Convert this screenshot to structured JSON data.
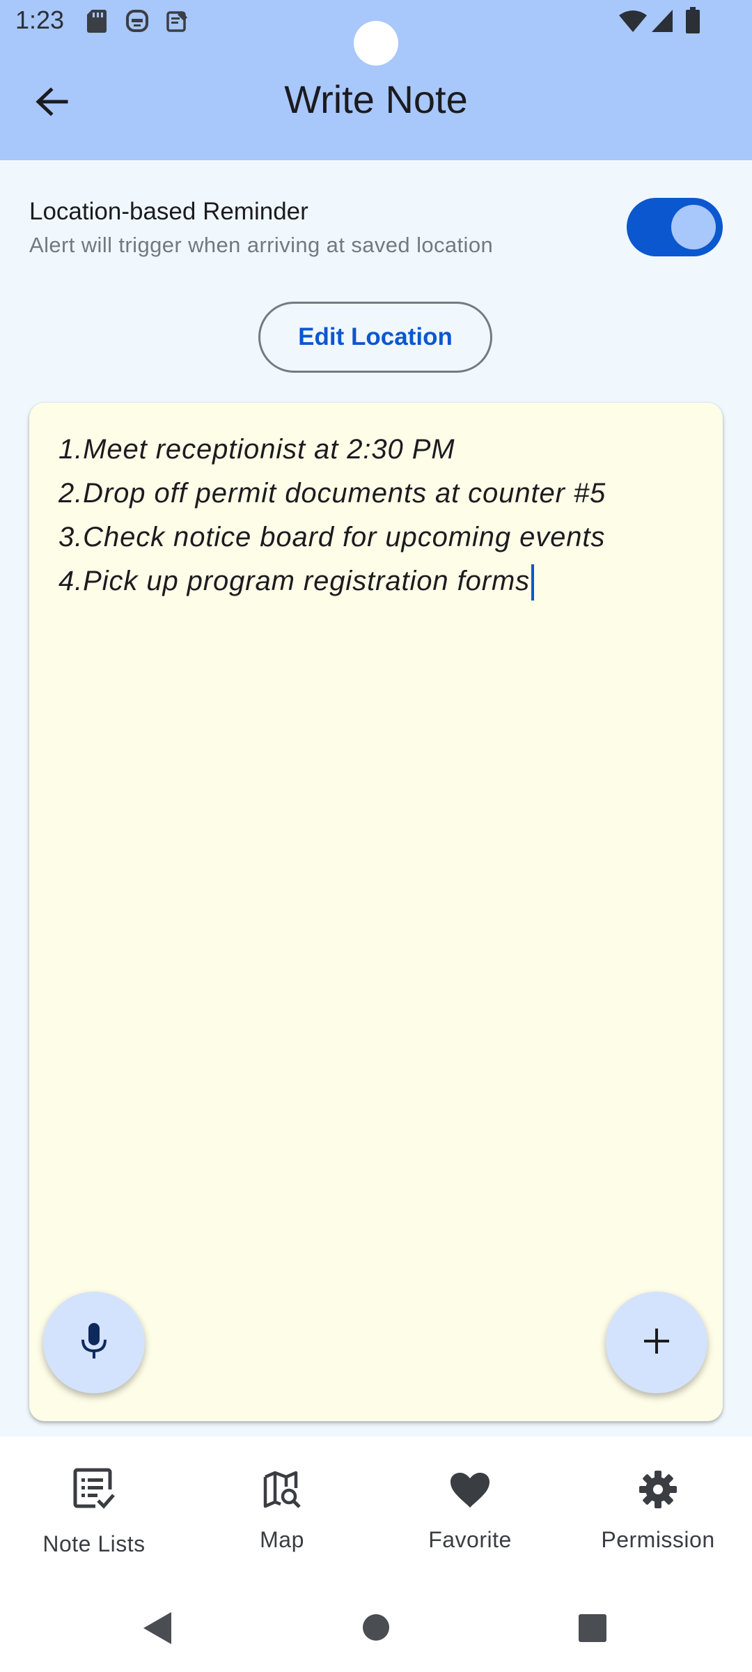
{
  "status_bar": {
    "time": "1:23",
    "left_icons": [
      "sd-card-icon",
      "assistant-icon",
      "notes-icon"
    ],
    "right_icons": [
      "wifi-icon",
      "signal-icon",
      "battery-icon"
    ]
  },
  "app_bar": {
    "title": "Write Note",
    "back_icon": "arrow-left-icon"
  },
  "reminder": {
    "title": "Location-based Reminder",
    "subtitle": "Alert will trigger when arriving at saved location",
    "enabled": true
  },
  "edit_location_label": "Edit Location",
  "note": {
    "lines": [
      "1.Meet receptionist at 2:30 PM",
      "2.Drop off permit documents at counter #5",
      "3.Check notice board for upcoming events",
      "4.Pick up program registration forms"
    ]
  },
  "fabs": {
    "mic_icon": "microphone-icon",
    "add_icon": "plus-icon"
  },
  "bottom_nav": {
    "items": [
      {
        "label": "Note Lists",
        "icon": "note-list-icon"
      },
      {
        "label": "Map",
        "icon": "map-search-icon"
      },
      {
        "label": "Favorite",
        "icon": "heart-icon"
      },
      {
        "label": "Permission",
        "icon": "gear-icon"
      }
    ]
  },
  "system_nav": [
    "back-triangle-icon",
    "home-circle-icon",
    "recents-square-icon"
  ],
  "colors": {
    "app_bar": "#a8c7fa",
    "background": "#f0f8fe",
    "accent": "#0b57d0",
    "note_card": "#fefde8",
    "fab": "#d3e3fd"
  }
}
